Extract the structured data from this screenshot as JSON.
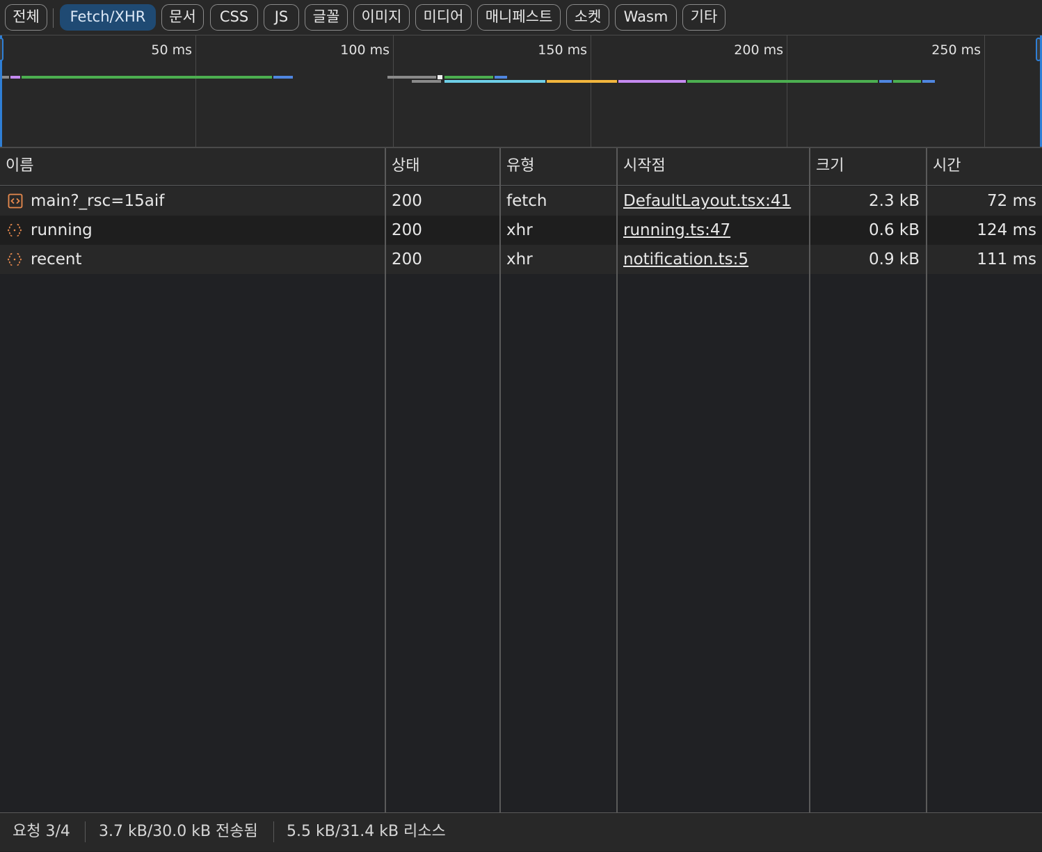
{
  "filters": [
    {
      "label": "전체",
      "active": false
    },
    {
      "label": "Fetch/XHR",
      "active": true
    },
    {
      "label": "문서",
      "active": false
    },
    {
      "label": "CSS",
      "active": false
    },
    {
      "label": "JS",
      "active": false
    },
    {
      "label": "글꼴",
      "active": false
    },
    {
      "label": "이미지",
      "active": false
    },
    {
      "label": "미디어",
      "active": false
    },
    {
      "label": "매니페스트",
      "active": false
    },
    {
      "label": "소켓",
      "active": false
    },
    {
      "label": "Wasm",
      "active": false
    },
    {
      "label": "기타",
      "active": false
    }
  ],
  "overview": {
    "ticks": [
      "50 ms",
      "100 ms",
      "150 ms",
      "200 ms",
      "250 ms"
    ],
    "colors": {
      "queue": "#8a8a8a",
      "stalled": "#b3b3b3",
      "connect": "#f2b63d",
      "ssl": "#c58af0",
      "request": "#4caf50",
      "waiting": "#4caf50",
      "download": "#4f86e0",
      "dns": "#6ecfe8"
    }
  },
  "columns": {
    "name": "이름",
    "status": "상태",
    "type": "유형",
    "initiator": "시작점",
    "size": "크기",
    "time": "시간"
  },
  "requests": [
    {
      "name": "main?_rsc=15aif",
      "icon": "document-icon",
      "status": "200",
      "type": "fetch",
      "initiator": "DefaultLayout.tsx:41",
      "size": "2.3 kB",
      "time": "72 ms"
    },
    {
      "name": "running",
      "icon": "json-braces-icon",
      "status": "200",
      "type": "xhr",
      "initiator": "running.ts:47",
      "size": "0.6 kB",
      "time": "124 ms"
    },
    {
      "name": "recent",
      "icon": "json-braces-icon",
      "status": "200",
      "type": "xhr",
      "initiator": "notification.ts:5",
      "size": "0.9 kB",
      "time": "111 ms"
    }
  ],
  "status_bar": {
    "requests": "요청 3/4",
    "transferred": "3.7 kB/30.0 kB 전송됨",
    "resources": "5.5 kB/31.4 kB 리소스"
  }
}
